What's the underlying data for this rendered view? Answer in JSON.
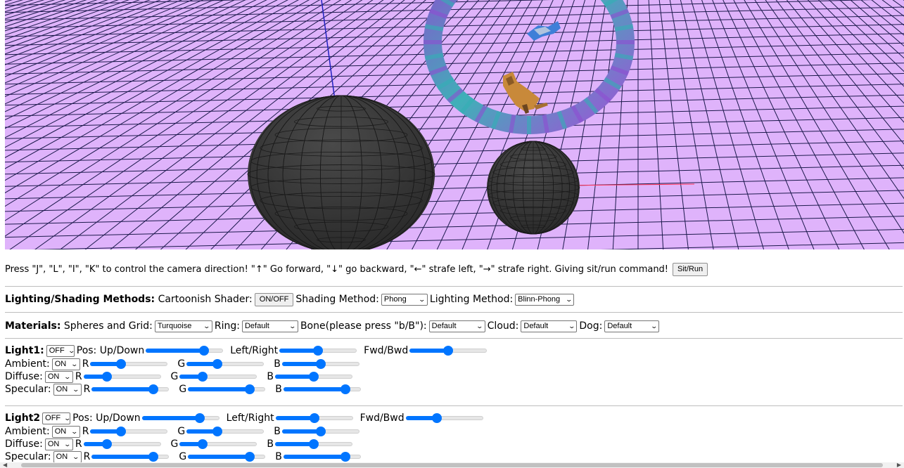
{
  "instructions": "Press \"J\", \"L\", \"I\", \"K\" to control the camera direction!  \"↑\"  Go forward,  \"↓\"  go backward,  \"←\"  strafe left,  \"→\"  strafe right. Giving sit/run command!",
  "sit_run_label": "Sit/Run",
  "lighting": {
    "heading": "Lighting/Shading Methods:",
    "cartoon_label": "Cartoonish Shader:",
    "cartoon_btn": "ON/OFF",
    "shading_label": "Shading Method:",
    "shading_value": "Phong",
    "lighting_label": "Lighting Method:",
    "lighting_value": "Blinn-Phong"
  },
  "materials": {
    "heading": "Materials:",
    "spheres_label": "Spheres and Grid:",
    "spheres_value": "Turquoise",
    "ring_label": "Ring:",
    "ring_value": "Default",
    "bone_label": "Bone(please press \"b/B\"):",
    "bone_value": "Default",
    "cloud_label": "Cloud:",
    "cloud_value": "Default",
    "dog_label": "Dog:",
    "dog_value": "Default"
  },
  "light1": {
    "heading": "Light1:",
    "state": "OFF",
    "pos_label": "Pos: Up/Down",
    "lr_label": "Left/Right",
    "fb_label": "Fwd/Bwd",
    "ambient_label": "Ambient:",
    "ambient_state": "ON",
    "diffuse_label": "Diffuse:",
    "diffuse_state": "ON",
    "specular_label": "Specular:",
    "specular_state": "ON"
  },
  "light2": {
    "heading": "Light2",
    "state": "OFF",
    "pos_label": "Pos: Up/Down",
    "lr_label": "Left/Right",
    "fb_label": "Fwd/Bwd",
    "ambient_label": "Ambient:",
    "ambient_state": "ON",
    "diffuse_label": "Diffuse:",
    "diffuse_state": "ON",
    "specular_label": "Specular:",
    "specular_state": "ON"
  },
  "rgb": {
    "r": "R",
    "g": "G",
    "b": "B"
  },
  "slider_values": {
    "l1_up": 0.75,
    "l1_lr": 0.5,
    "l1_fb": 0.5,
    "l1_amb_r": 0.4,
    "l1_amb_g": 0.4,
    "l1_amb_b": 0.5,
    "l1_dif_r": 0.3,
    "l1_dif_g": 0.3,
    "l1_dif_b": 0.5,
    "l1_spe_r": 0.8,
    "l1_spe_g": 0.8,
    "l1_spe_b": 0.8,
    "l2_up": 0.75,
    "l2_lr": 0.5,
    "l2_fb": 0.4,
    "l2_amb_r": 0.4,
    "l2_amb_g": 0.4,
    "l2_amb_b": 0.5,
    "l2_dif_r": 0.3,
    "l2_dif_g": 0.3,
    "l2_dif_b": 0.5,
    "l2_spe_r": 0.8,
    "l2_spe_g": 0.8,
    "l2_spe_b": 0.8
  },
  "colors": {
    "grid_bg": "#dfb3fb",
    "grid_line": "#1c1a4c",
    "sphere": "#3a3a3a",
    "ring_a": "#9a4fd6",
    "ring_b": "#2fb3b0",
    "accent": "#0075ff"
  }
}
